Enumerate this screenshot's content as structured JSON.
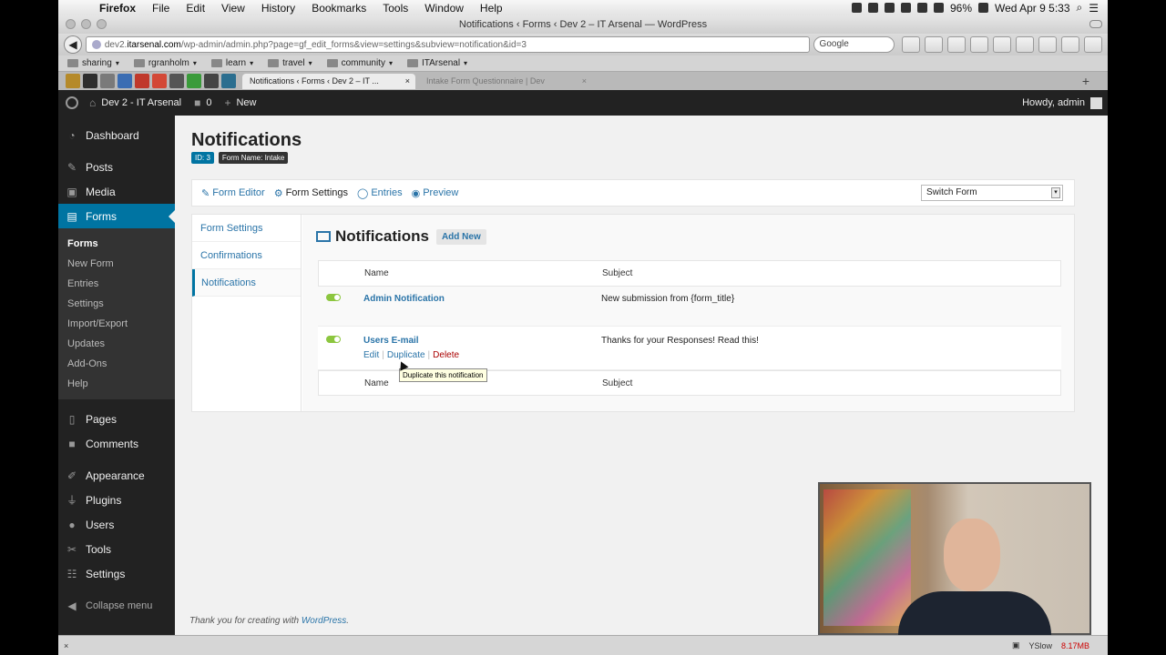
{
  "mac_menu": {
    "app": "Firefox",
    "items": [
      "File",
      "Edit",
      "View",
      "History",
      "Bookmarks",
      "Tools",
      "Window",
      "Help"
    ],
    "battery": "96%",
    "clock": "Wed Apr 9  5:33"
  },
  "window_title": "Notifications ‹ Forms ‹ Dev 2 – IT Arsenal — WordPress",
  "url": {
    "prefix": "dev2.",
    "domain": "itarsenal.com",
    "path": "/wp-admin/admin.php?page=gf_edit_forms&view=settings&subview=notification&id=3"
  },
  "search_engine": "Google",
  "bookmarks": [
    "sharing",
    "rgranholm",
    "learn",
    "travel",
    "community",
    "ITArsenal"
  ],
  "tabs": [
    {
      "label": "Notifications ‹ Forms ‹ Dev 2 – IT ...",
      "active": true
    },
    {
      "label": "Intake Form Questionnaire | Dev",
      "active": false
    }
  ],
  "wp_admin_bar": {
    "site": "Dev 2 - IT Arsenal",
    "comments": "0",
    "new": "New",
    "howdy": "Howdy, admin"
  },
  "sidebar": {
    "items": [
      {
        "label": "Dashboard",
        "icon": "dashboard-icon"
      },
      {
        "label": "Posts",
        "icon": "pin-icon"
      },
      {
        "label": "Media",
        "icon": "media-icon"
      },
      {
        "label": "Forms",
        "icon": "forms-icon"
      },
      {
        "label": "Pages",
        "icon": "pages-icon"
      },
      {
        "label": "Comments",
        "icon": "comment-icon"
      },
      {
        "label": "Appearance",
        "icon": "brush-icon"
      },
      {
        "label": "Plugins",
        "icon": "plug-icon"
      },
      {
        "label": "Users",
        "icon": "user-icon"
      },
      {
        "label": "Tools",
        "icon": "wrench-icon"
      },
      {
        "label": "Settings",
        "icon": "sliders-icon"
      }
    ],
    "forms_submenu": [
      "Forms",
      "New Form",
      "Entries",
      "Settings",
      "Import/Export",
      "Updates",
      "Add-Ons",
      "Help"
    ],
    "collapse": "Collapse menu"
  },
  "page": {
    "title": "Notifications",
    "id_badge": "ID: 3",
    "name_badge": "Form Name: Intake",
    "toolbar": {
      "form_editor": "Form Editor",
      "form_settings": "Form Settings",
      "entries": "Entries",
      "preview": "Preview",
      "switch_form": "Switch Form"
    },
    "subnav": [
      "Form Settings",
      "Confirmations",
      "Notifications"
    ],
    "section_title": "Notifications",
    "add_new": "Add New",
    "table": {
      "col_name": "Name",
      "col_subject": "Subject",
      "rows": [
        {
          "name": "Admin Notification",
          "subject": "New submission from {form_title}"
        },
        {
          "name": "Users E-mail",
          "subject": "Thanks for your Responses! Read this!"
        }
      ],
      "actions": {
        "edit": "Edit",
        "duplicate": "Duplicate",
        "delete": "Delete"
      },
      "tooltip": "Duplicate this notification"
    },
    "footer_prefix": "Thank you for creating with ",
    "footer_link": "WordPress",
    "footer_suffix": "."
  },
  "statusbar": {
    "close": "×",
    "yslow": "YSlow",
    "timing": "8.17MB"
  },
  "colors": {
    "wp_blue": "#0074a2",
    "link": "#2a74a8",
    "toggle_on": "#8cc63f",
    "admin_dark": "#222222"
  }
}
